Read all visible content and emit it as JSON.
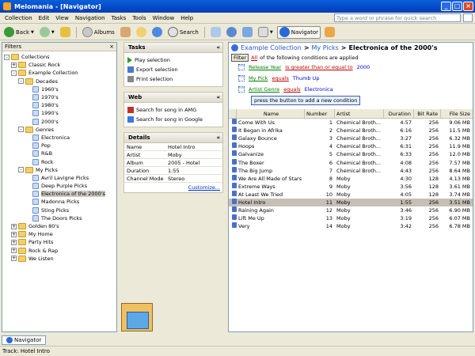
{
  "window": {
    "title": "Melomania - [Navigator]"
  },
  "menu": [
    "Collection",
    "Edit",
    "View",
    "Navigation",
    "Tasks",
    "Tools",
    "Window",
    "Help"
  ],
  "quick_search": {
    "placeholder": "Type a word or phrase for quick search"
  },
  "toolbar": {
    "back": "Back",
    "albums": "Albums",
    "search": "Search",
    "navigator": "Navigator"
  },
  "filters": {
    "header": "Filters",
    "tree": [
      {
        "label": "Collections",
        "level": 0,
        "kind": "folder",
        "exp": "-"
      },
      {
        "label": "Classic Rock",
        "level": 1,
        "kind": "folder",
        "exp": "+"
      },
      {
        "label": "Example Collection",
        "level": 1,
        "kind": "folder",
        "exp": "-"
      },
      {
        "label": "Decades",
        "level": 2,
        "kind": "folder",
        "exp": "-"
      },
      {
        "label": "1960's",
        "level": 3,
        "kind": "pick",
        "exp": ""
      },
      {
        "label": "1970's",
        "level": 3,
        "kind": "pick",
        "exp": ""
      },
      {
        "label": "1980's",
        "level": 3,
        "kind": "pick",
        "exp": ""
      },
      {
        "label": "1990's",
        "level": 3,
        "kind": "pick",
        "exp": ""
      },
      {
        "label": "2000's",
        "level": 3,
        "kind": "pick",
        "exp": ""
      },
      {
        "label": "Genres",
        "level": 2,
        "kind": "folder",
        "exp": "-"
      },
      {
        "label": "Electronica",
        "level": 3,
        "kind": "pick",
        "exp": ""
      },
      {
        "label": "Pop",
        "level": 3,
        "kind": "pick",
        "exp": ""
      },
      {
        "label": "R&B",
        "level": 3,
        "kind": "pick",
        "exp": ""
      },
      {
        "label": "Rock",
        "level": 3,
        "kind": "pick",
        "exp": ""
      },
      {
        "label": "My Picks",
        "level": 2,
        "kind": "folder",
        "exp": "-"
      },
      {
        "label": "Avril Lavigne Picks",
        "level": 3,
        "kind": "pick",
        "exp": ""
      },
      {
        "label": "Deep Purple Picks",
        "level": 3,
        "kind": "pick",
        "exp": ""
      },
      {
        "label": "Electronica of the 2000's",
        "level": 3,
        "kind": "pick",
        "exp": "",
        "selected": true
      },
      {
        "label": "Madonna Picks",
        "level": 3,
        "kind": "pick",
        "exp": ""
      },
      {
        "label": "Sting Picks",
        "level": 3,
        "kind": "pick",
        "exp": ""
      },
      {
        "label": "The Doors Picks",
        "level": 3,
        "kind": "pick",
        "exp": ""
      },
      {
        "label": "Golden 80's",
        "level": 1,
        "kind": "folder",
        "exp": "+"
      },
      {
        "label": "My Home",
        "level": 1,
        "kind": "folder",
        "exp": "+"
      },
      {
        "label": "Party Hits",
        "level": 1,
        "kind": "folder",
        "exp": "+"
      },
      {
        "label": "Rock & Rap",
        "level": 1,
        "kind": "folder",
        "exp": "+"
      },
      {
        "label": "We Listen",
        "level": 1,
        "kind": "folder",
        "exp": "+"
      }
    ]
  },
  "tasks": {
    "header": "Tasks",
    "items": [
      "Play selection",
      "Export selection",
      "Print selection"
    ]
  },
  "web": {
    "header": "Web",
    "items": [
      "Search for song in AMG",
      "Search for song in Google"
    ]
  },
  "details": {
    "header": "Details",
    "rows": [
      {
        "k": "Name",
        "v": "Hotel Intro"
      },
      {
        "k": "Artist",
        "v": "Moby"
      },
      {
        "k": "Album",
        "v": "2005 - Hotel"
      },
      {
        "k": "Duration",
        "v": "1:55"
      },
      {
        "k": "Channel Mode",
        "v": "Stereo"
      }
    ],
    "customize": "Customize..."
  },
  "breadcrumb": {
    "a": "Example Collection",
    "sep": ">",
    "b": "My Picks",
    "c": "Electronica of the 2000's"
  },
  "conditions": {
    "filter_btn": "Filter",
    "all": "All",
    "rest": "of the following conditions are applied",
    "items": [
      {
        "field": "Release Year",
        "op": "is greater than or equal to",
        "value": "2000"
      },
      {
        "field": "My Pick",
        "op": "equals",
        "value": "Thumb Up"
      },
      {
        "field": "Artist Genre",
        "op": "equals",
        "value": "Electronica"
      }
    ],
    "add_button": "press the button to add a new condition"
  },
  "table": {
    "headers": [
      "Name",
      "Number",
      "Artist",
      "Duration",
      "Bit Rate",
      "File Size"
    ],
    "rows": [
      {
        "name": "Come With Us",
        "num": "1",
        "artist": "Chemical Broth...",
        "dur": "4:57",
        "bit": "256",
        "size": "9.06 MB"
      },
      {
        "name": "It Began in Afrika",
        "num": "2",
        "artist": "Chemical Broth...",
        "dur": "6:16",
        "bit": "256",
        "size": "11.5 MB"
      },
      {
        "name": "Galaxy Bounce",
        "num": "3",
        "artist": "Chemical Broth...",
        "dur": "3:27",
        "bit": "256",
        "size": "6.32 MB"
      },
      {
        "name": "Hoops",
        "num": "4",
        "artist": "Chemical Broth...",
        "dur": "6:31",
        "bit": "256",
        "size": "11.9 MB"
      },
      {
        "name": "Galvanize",
        "num": "5",
        "artist": "Chemical Broth...",
        "dur": "6:33",
        "bit": "256",
        "size": "12.0 MB"
      },
      {
        "name": "The Boxer",
        "num": "6",
        "artist": "Chemical Broth...",
        "dur": "4:08",
        "bit": "256",
        "size": "7.57 MB"
      },
      {
        "name": "The Big Jump",
        "num": "7",
        "artist": "Chemical Broth...",
        "dur": "4:43",
        "bit": "256",
        "size": "8.64 MB"
      },
      {
        "name": "We Are All Made of Stars",
        "num": "8",
        "artist": "Moby",
        "dur": "4:30",
        "bit": "128",
        "size": "4.13 MB"
      },
      {
        "name": "Extreme Ways",
        "num": "9",
        "artist": "Moby",
        "dur": "3:56",
        "bit": "128",
        "size": "3.61 MB"
      },
      {
        "name": "At Least We Tried",
        "num": "10",
        "artist": "Moby",
        "dur": "4:05",
        "bit": "128",
        "size": "3.74 MB"
      },
      {
        "name": "Hotel Intro",
        "num": "11",
        "artist": "Moby",
        "dur": "1:55",
        "bit": "256",
        "size": "3.51 MB",
        "selected": true
      },
      {
        "name": "Raining Again",
        "num": "12",
        "artist": "Moby",
        "dur": "3:46",
        "bit": "256",
        "size": "6.90 MB"
      },
      {
        "name": "Lift Me Up",
        "num": "13",
        "artist": "Moby",
        "dur": "3:19",
        "bit": "256",
        "size": "6.07 MB"
      },
      {
        "name": "Very",
        "num": "14",
        "artist": "Moby",
        "dur": "3:42",
        "bit": "256",
        "size": "6.78 MB"
      }
    ]
  },
  "bottom_tab": "Navigator",
  "status": "Track: Hotel Intro"
}
